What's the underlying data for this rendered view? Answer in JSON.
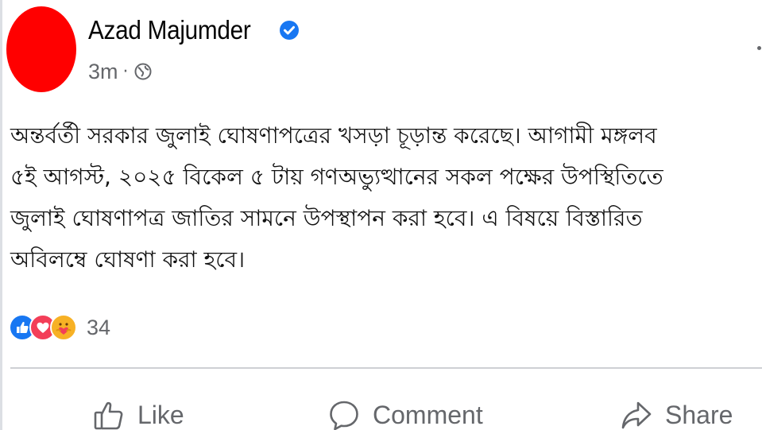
{
  "post": {
    "author": "Azad Majumder",
    "verified_icon": "verified-badge-icon",
    "timestamp": "3m",
    "separator": "·",
    "audience_icon": "globe-icon",
    "body_lines": [
      "অন্তর্বর্তী সরকার জুলাই ঘোষণাপত্রের খসড়া চূড়ান্ত করেছে। আগামী মঙ্গলব",
      "৫ই আগস্ট, ২০২৫ বিকেল ৫ টায় গণঅভ্যুত্থানের সকল পক্ষের উপস্থিতিতে",
      "জুলাই ঘোষণাপত্র জাতির সামনে উপস্থাপন করা হবে। এ বিষয়ে বিস্তারিত",
      "অবিলম্বে ঘোষণা করা হবে।"
    ],
    "reactions": {
      "icons": [
        "like-reaction-icon",
        "love-reaction-icon",
        "care-reaction-icon"
      ],
      "count": "34"
    },
    "actions": {
      "like": "Like",
      "comment": "Comment",
      "share": "Share"
    }
  },
  "colors": {
    "avatar": "#ff0000",
    "verified": "#1877f2",
    "like": "#1877f2",
    "love": "#f33e58",
    "care": "#f7b125",
    "secondary_text": "#65676b",
    "divider": "#ced0d4"
  }
}
